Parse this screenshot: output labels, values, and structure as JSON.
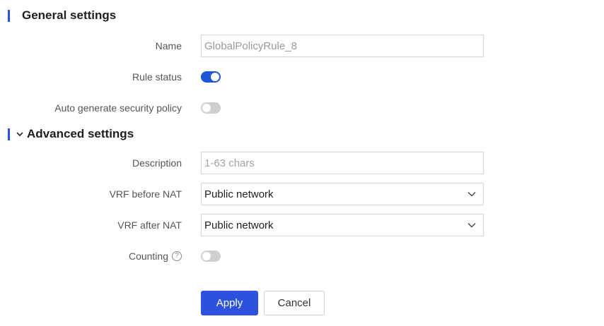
{
  "general": {
    "title": "General settings",
    "name_label": "Name",
    "name_value": "GlobalPolicyRule_8",
    "rule_status_label": "Rule status",
    "rule_status_on": true,
    "auto_policy_label": "Auto generate security policy",
    "auto_policy_on": false
  },
  "advanced": {
    "title": "Advanced settings",
    "expanded": true,
    "description_label": "Description",
    "description_placeholder": "1-63 chars",
    "description_value": "",
    "vrf_before_label": "VRF before NAT",
    "vrf_before_value": "Public network",
    "vrf_after_label": "VRF after NAT",
    "vrf_after_value": "Public network",
    "counting_label": "Counting",
    "counting_help": "?",
    "counting_on": false
  },
  "actions": {
    "apply_label": "Apply",
    "cancel_label": "Cancel"
  },
  "colors": {
    "accent": "#2b50e0",
    "toggle_on": "#1e56d8",
    "toggle_off": "#cfcfcf"
  }
}
